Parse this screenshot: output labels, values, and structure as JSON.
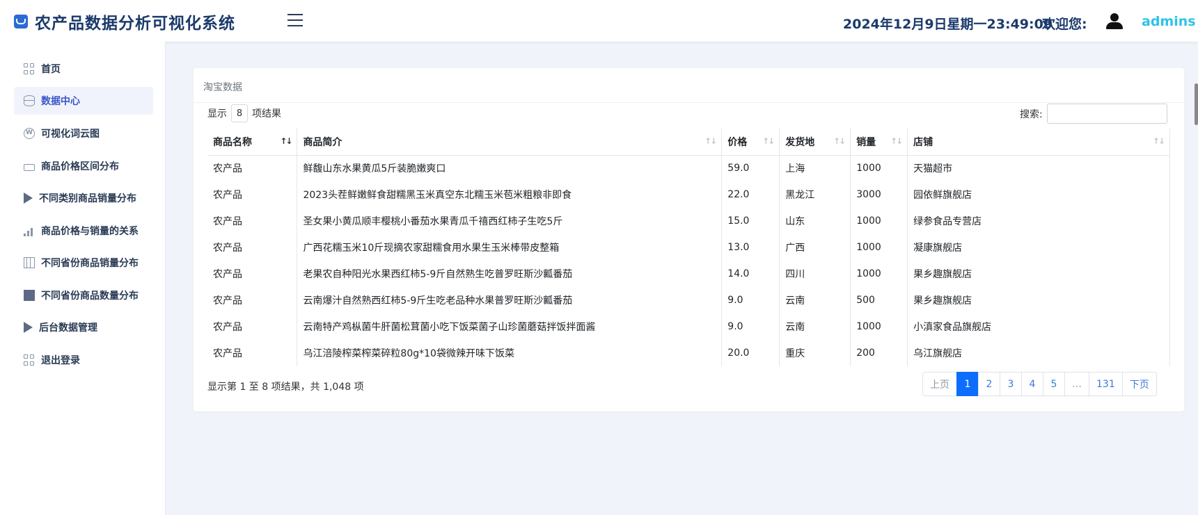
{
  "header": {
    "title": "农产品数据分析可视化系统",
    "datetime": "2024年12月9日星期一23:49:09",
    "welcome": "欢迎您:",
    "username": "admins"
  },
  "sidebar": {
    "items": [
      {
        "label": "首页",
        "icon": "grid-icon"
      },
      {
        "label": "数据中心",
        "icon": "database-icon",
        "active": true
      },
      {
        "label": "可视化词云图",
        "icon": "wordpress-icon"
      },
      {
        "label": "商品价格区间分布",
        "icon": "printer-icon"
      },
      {
        "label": "不同类别商品销量分布",
        "icon": "play-icon"
      },
      {
        "label": "商品价格与销量的关系",
        "icon": "bar-chart-icon"
      },
      {
        "label": "不同省份商品销量分布",
        "icon": "map-icon"
      },
      {
        "label": "不同省份商品数量分布",
        "icon": "map-filled-icon"
      },
      {
        "label": "后台数据管理",
        "icon": "play-icon"
      },
      {
        "label": "退出登录",
        "icon": "grid-icon"
      }
    ]
  },
  "card": {
    "title": "淘宝数据",
    "length_prefix": "显示",
    "length_value": "8",
    "length_suffix": "项结果",
    "search_label": "搜索:",
    "search_value": ""
  },
  "table": {
    "columns": [
      "商品名称",
      "商品简介",
      "价格",
      "发货地",
      "销量",
      "店铺"
    ],
    "rows": [
      [
        "农产品",
        "鲜馥山东水果黄瓜5斤装脆嫩爽口",
        "59.0",
        "上海",
        "1000",
        "天猫超市"
      ],
      [
        "农产品",
        "2023头茬鲜嫩鲜食甜糯黑玉米真空东北糯玉米苞米粗粮非即食",
        "22.0",
        "黑龙江",
        "3000",
        "园依鲜旗舰店"
      ],
      [
        "农产品",
        "圣女果小黄瓜顺丰樱桃小番茄水果青瓜千禧西红柿子生吃5斤",
        "15.0",
        "山东",
        "1000",
        "绿参食品专营店"
      ],
      [
        "农产品",
        "广西花糯玉米10斤现摘农家甜糯食用水果生玉米棒带皮整箱",
        "13.0",
        "广西",
        "1000",
        "凝康旗舰店"
      ],
      [
        "农产品",
        "老果农自种阳光水果西红柿5-9斤自然熟生吃普罗旺斯沙瓤番茄",
        "14.0",
        "四川",
        "1000",
        "果乡趣旗舰店"
      ],
      [
        "农产品",
        "云南爆汁自然熟西红柿5-9斤生吃老品种水果普罗旺斯沙瓤番茄",
        "9.0",
        "云南",
        "500",
        "果乡趣旗舰店"
      ],
      [
        "农产品",
        "云南特产鸡枞菌牛肝菌松茸菌小吃下饭菜菌子山珍菌蘑菇拌饭拌面酱",
        "9.0",
        "云南",
        "1000",
        "小滇家食品旗舰店"
      ],
      [
        "农产品",
        "乌江涪陵榨菜榨菜碎粒80g*10袋微辣开味下饭菜",
        "20.0",
        "重庆",
        "200",
        "乌江旗舰店"
      ]
    ]
  },
  "footer": {
    "info": "显示第 1 至 8 项结果，共 1,048 项",
    "pages": [
      "上页",
      "1",
      "2",
      "3",
      "4",
      "5",
      "…",
      "131",
      "下页"
    ],
    "active_page": "1"
  }
}
